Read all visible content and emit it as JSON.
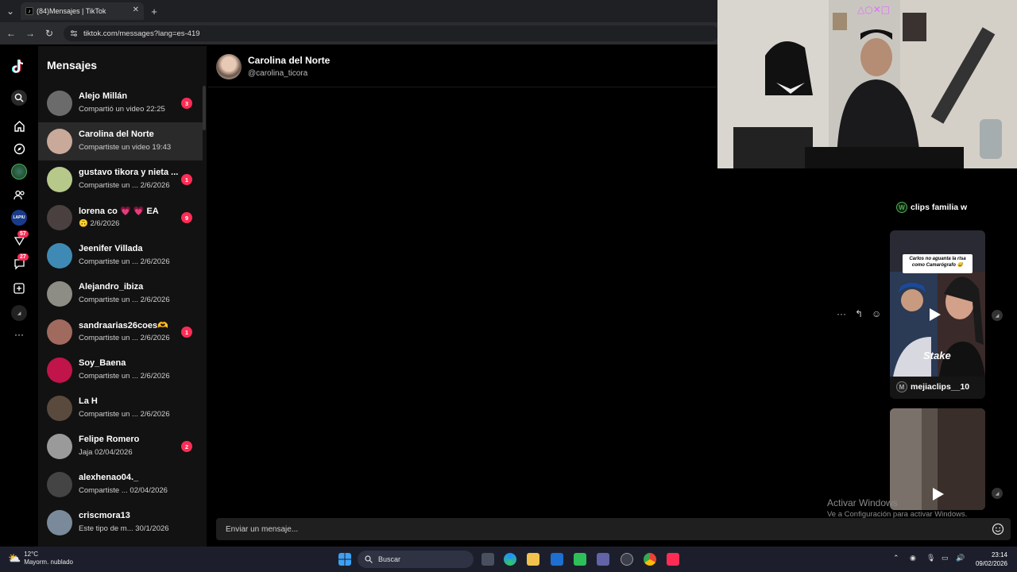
{
  "browser": {
    "tab_title": "(84)Mensajes | TikTok",
    "new_tab": "+",
    "url": "tiktok.com/messages?lang=es-419"
  },
  "rail": {
    "badge_activity": "57",
    "badge_messages": "27",
    "more": "···"
  },
  "sidebar": {
    "title": "Mensajes",
    "conversations": [
      {
        "name": "Alejo Millán",
        "preview": "Compartió un video",
        "time": "22:25",
        "unread": "3",
        "avatar_color": "#6b6b6b"
      },
      {
        "name": "Carolina del Norte",
        "preview": "Compartiste un video",
        "time": "19:43",
        "unread": "",
        "avatar_color": "#c9a99a"
      },
      {
        "name": "gustavo tikora y nieta ...",
        "preview": "Compartiste un ...",
        "time": "2/6/2026",
        "unread": "1",
        "avatar_color": "#b6c98a"
      },
      {
        "name": "lorena co 💗 💗 EA",
        "preview": "🙃",
        "time": "2/6/2026",
        "unread": "9",
        "avatar_color": "#4a4040"
      },
      {
        "name": "Jeenifer Villada",
        "preview": "Compartiste un ...",
        "time": "2/6/2026",
        "unread": "",
        "avatar_color": "#3f8ab5"
      },
      {
        "name": "Alejandro_ibiza",
        "preview": "Compartiste un ...",
        "time": "2/6/2026",
        "unread": "",
        "avatar_color": "#8d8d85"
      },
      {
        "name": "sandraarias26coes🫶",
        "preview": "Compartiste un ...",
        "time": "2/6/2026",
        "unread": "1",
        "avatar_color": "#a06a5e"
      },
      {
        "name": "Soy_Baena",
        "preview": "Compartiste un ...",
        "time": "2/6/2026",
        "unread": "",
        "avatar_color": "#c0144a"
      },
      {
        "name": "La H",
        "preview": "Compartiste un ...",
        "time": "2/6/2026",
        "unread": "",
        "avatar_color": "#5a4a3e"
      },
      {
        "name": "Felipe Romero",
        "preview": "Jaja",
        "time": "02/04/2026",
        "unread": "2",
        "avatar_color": "#9a9a9a"
      },
      {
        "name": "alexhenao04._",
        "preview": "Compartiste ...",
        "time": "02/04/2026",
        "unread": "",
        "avatar_color": "#444444"
      },
      {
        "name": "criscmora13",
        "preview": "Este tipo de m...",
        "time": "30/1/2026",
        "unread": "",
        "avatar_color": "#7a8a9a"
      }
    ]
  },
  "chat": {
    "name": "Carolina del Norte",
    "handle": "@carolina_ticora",
    "card1_label": "clips familia w",
    "card2_caption": "Carlos no aguanta la risa como Camarógrafo 😅",
    "card2_watermark": "Stake",
    "card2_label": "mejiaclips__10",
    "composer_placeholder": "Enviar un mensaje...",
    "activate_line1": "Activar Windows",
    "activate_line2": "Ve a Configuración para activar Windows."
  },
  "taskbar": {
    "temp": "12°C",
    "weather": "Mayorm. nublado",
    "search": "Buscar",
    "time": "23:14",
    "date": "09/02/2026"
  }
}
